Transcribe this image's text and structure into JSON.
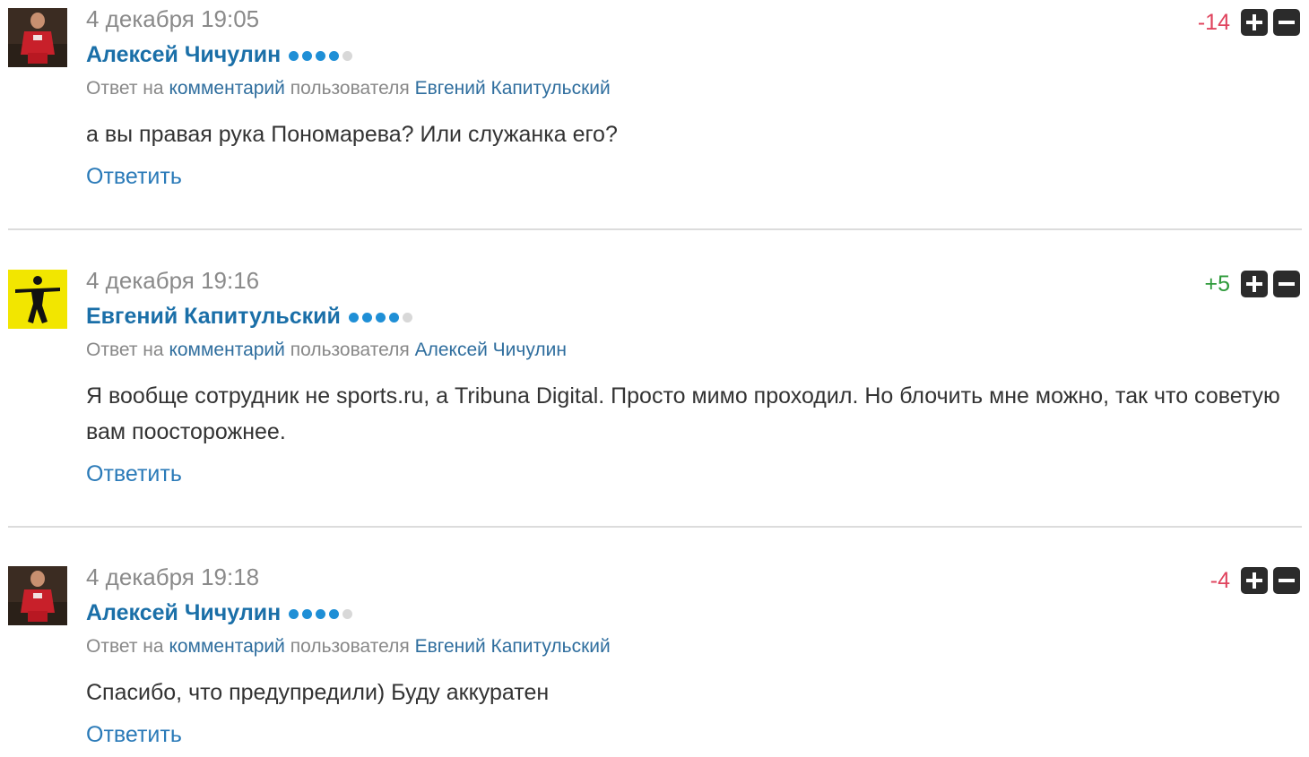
{
  "comments": [
    {
      "date": "4 декабря 19:05",
      "author": "Алексей Чичулин",
      "reply_prefix": "Ответ на",
      "reply_comment_link": "комментарий",
      "reply_middle": "пользователя",
      "reply_user": "Евгений Капитульский",
      "text": "а вы правая рука Пономарева? Или служанка его?",
      "reply_label": "Ответить",
      "score": "-14",
      "rating_dots_filled": 4,
      "rating_dots_total": 5
    },
    {
      "date": "4 декабря 19:16",
      "author": "Евгений Капитульский",
      "reply_prefix": "Ответ на",
      "reply_comment_link": "комментарий",
      "reply_middle": "пользователя",
      "reply_user": "Алексей Чичулин",
      "text": "Я вообще сотрудник не sports.ru, а Tribuna Digital. Просто мимо проходил. Но блочить мне можно, так что советую вам поосторожнее.",
      "reply_label": "Ответить",
      "score": "+5",
      "rating_dots_filled": 4,
      "rating_dots_total": 5
    },
    {
      "date": "4 декабря 19:18",
      "author": "Алексей Чичулин",
      "reply_prefix": "Ответ на",
      "reply_comment_link": "комментарий",
      "reply_middle": "пользователя",
      "reply_user": "Евгений Капитульский",
      "text": "Спасибо, что предупредили) Буду аккуратен",
      "reply_label": "Ответить",
      "score": "-4",
      "rating_dots_filled": 4,
      "rating_dots_total": 5
    }
  ],
  "icons": {
    "upvote": "plus-icon",
    "downvote": "minus-icon"
  },
  "colors": {
    "link": "#1a6fa8",
    "negative_score": "#e0445e",
    "positive_score": "#2e9a3a",
    "rating_dot": "#1f8fd6",
    "vote_button": "#2b2b2b"
  }
}
